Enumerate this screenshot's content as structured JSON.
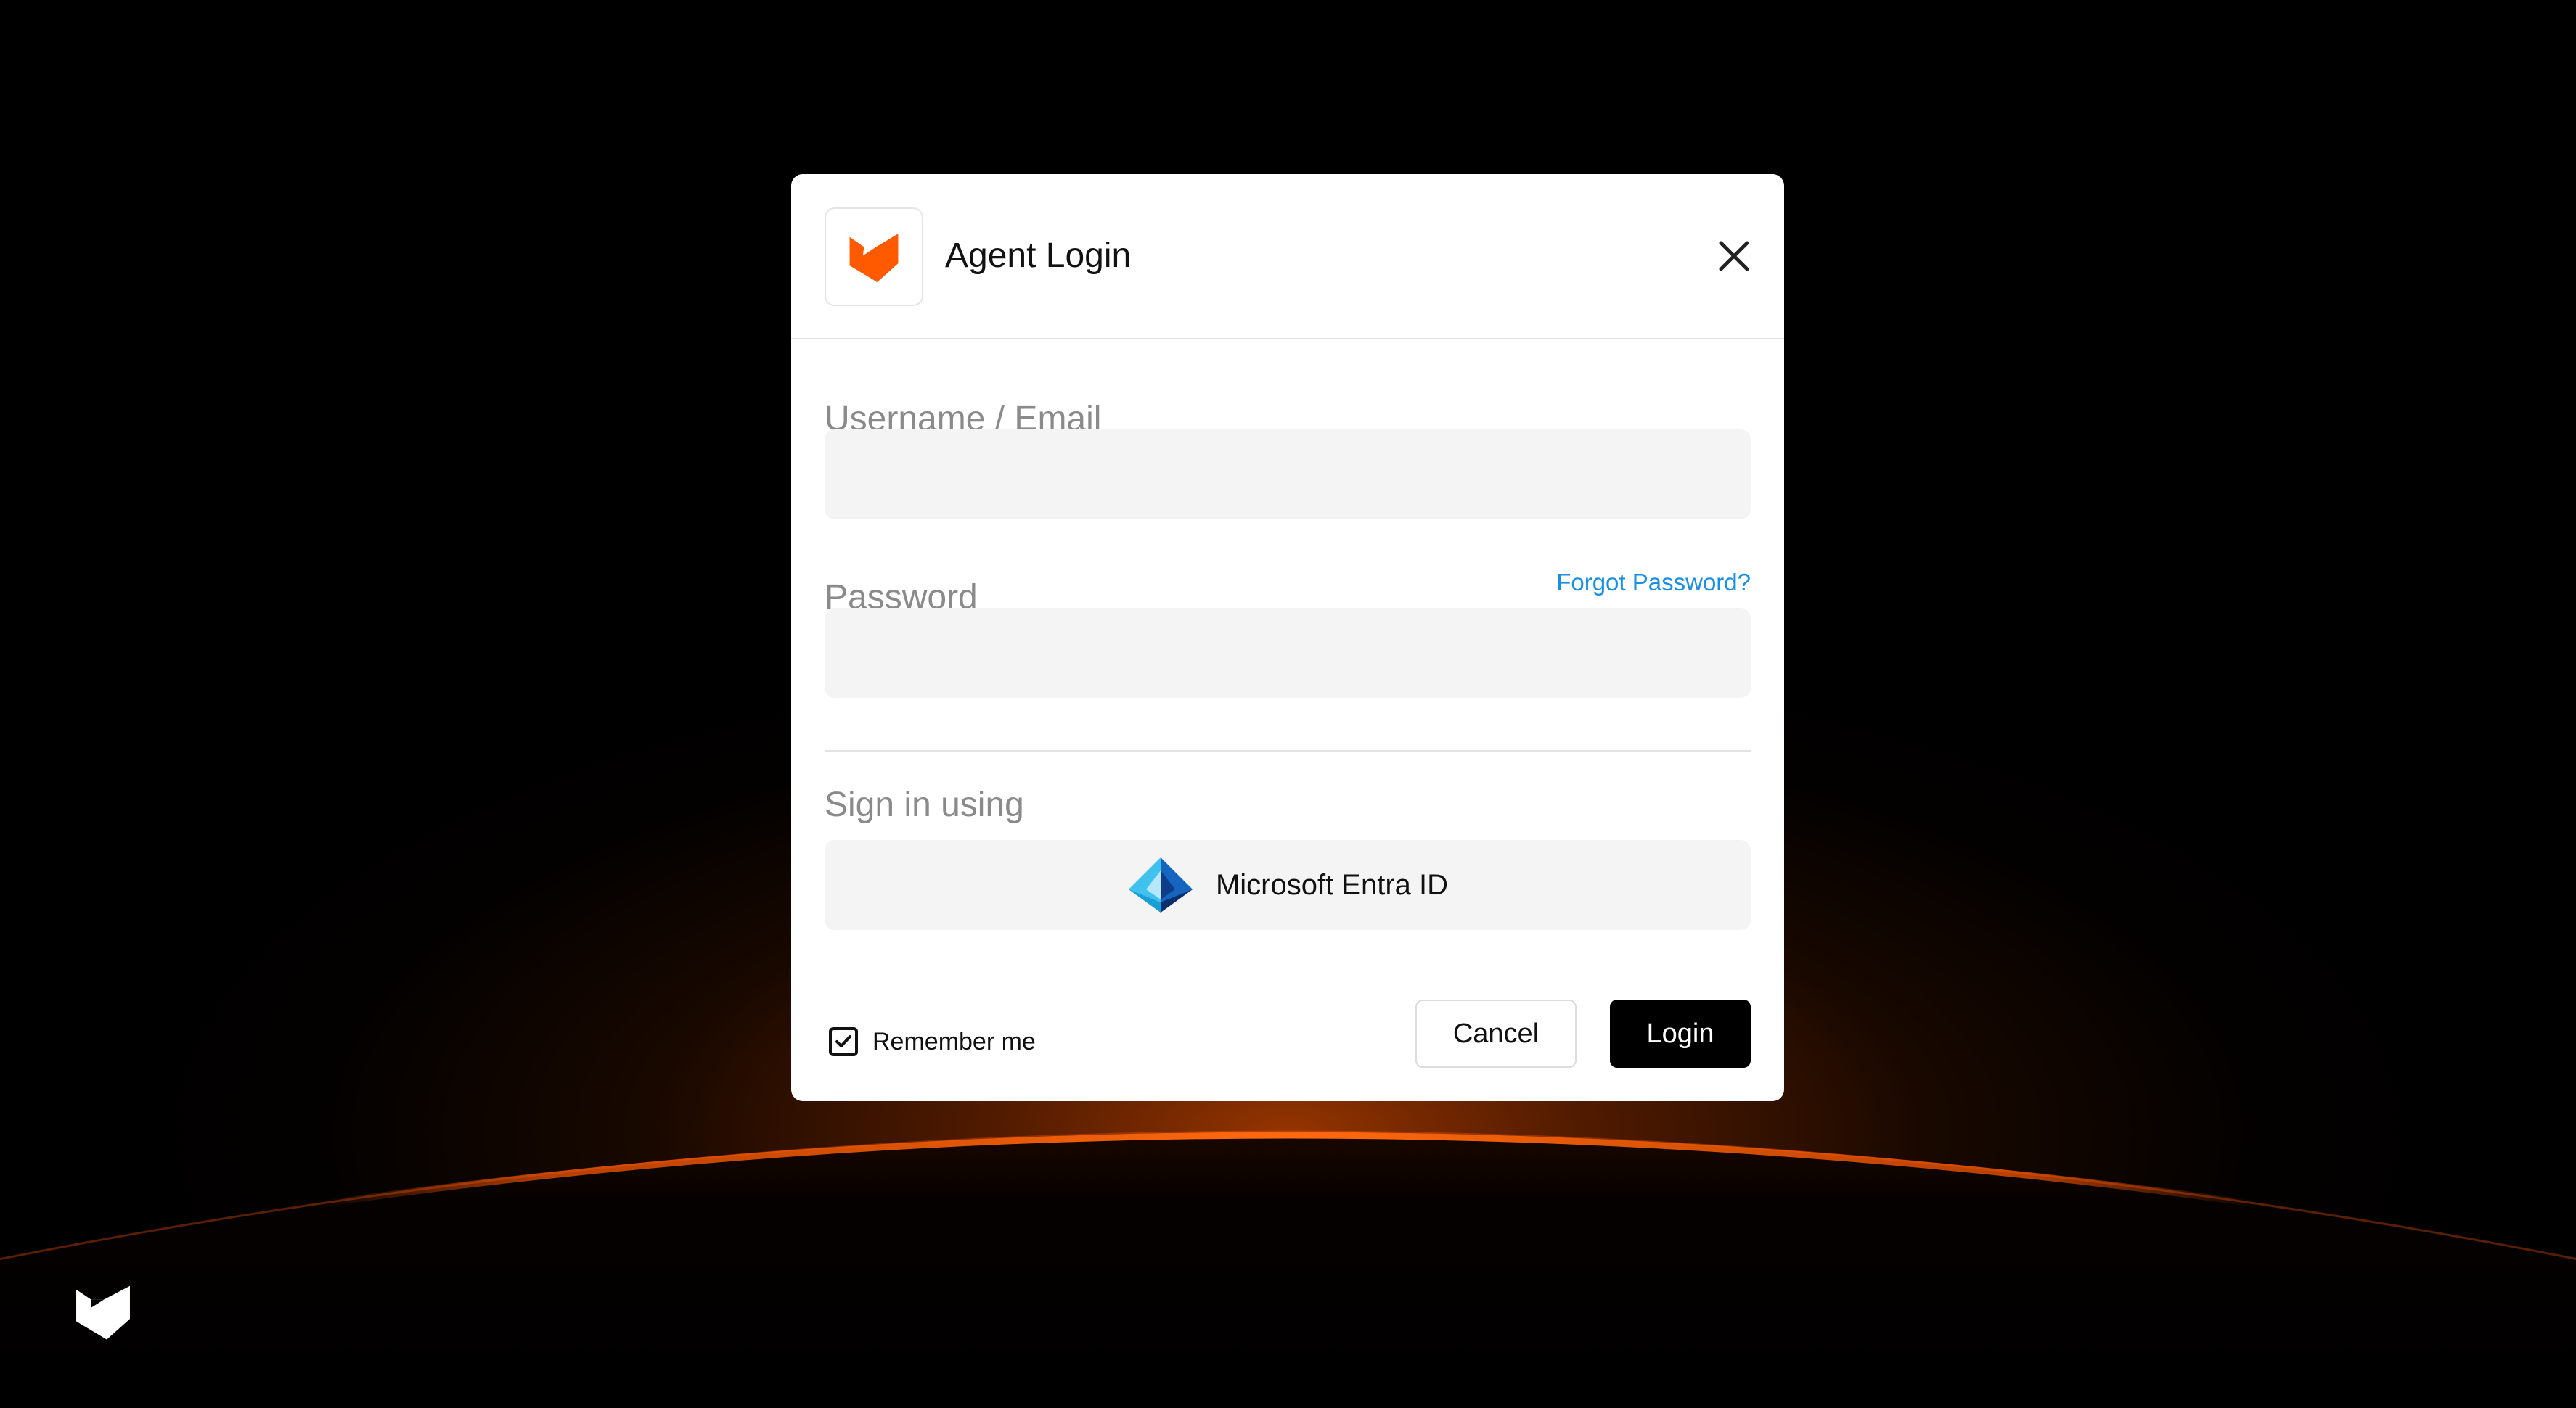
{
  "dialog": {
    "title": "Agent Login",
    "logo_icon": "brand-shield-logo",
    "close_icon": "close-x-icon"
  },
  "form": {
    "username_label": "Username / Email",
    "username_value": "",
    "password_label": "Password",
    "password_value": "",
    "forgot_password": "Forgot Password?",
    "sign_in_using": "Sign in using",
    "sso_provider": "Microsoft Entra ID",
    "sso_icon": "microsoft-entra-id-icon",
    "remember_me": "Remember me",
    "remember_me_checked": true
  },
  "actions": {
    "cancel": "Cancel",
    "login": "Login"
  },
  "colors": {
    "accent_orange": "#ff5a00",
    "link_blue": "#1a8fe0",
    "background": "#000000",
    "primary_button": "#000000"
  }
}
